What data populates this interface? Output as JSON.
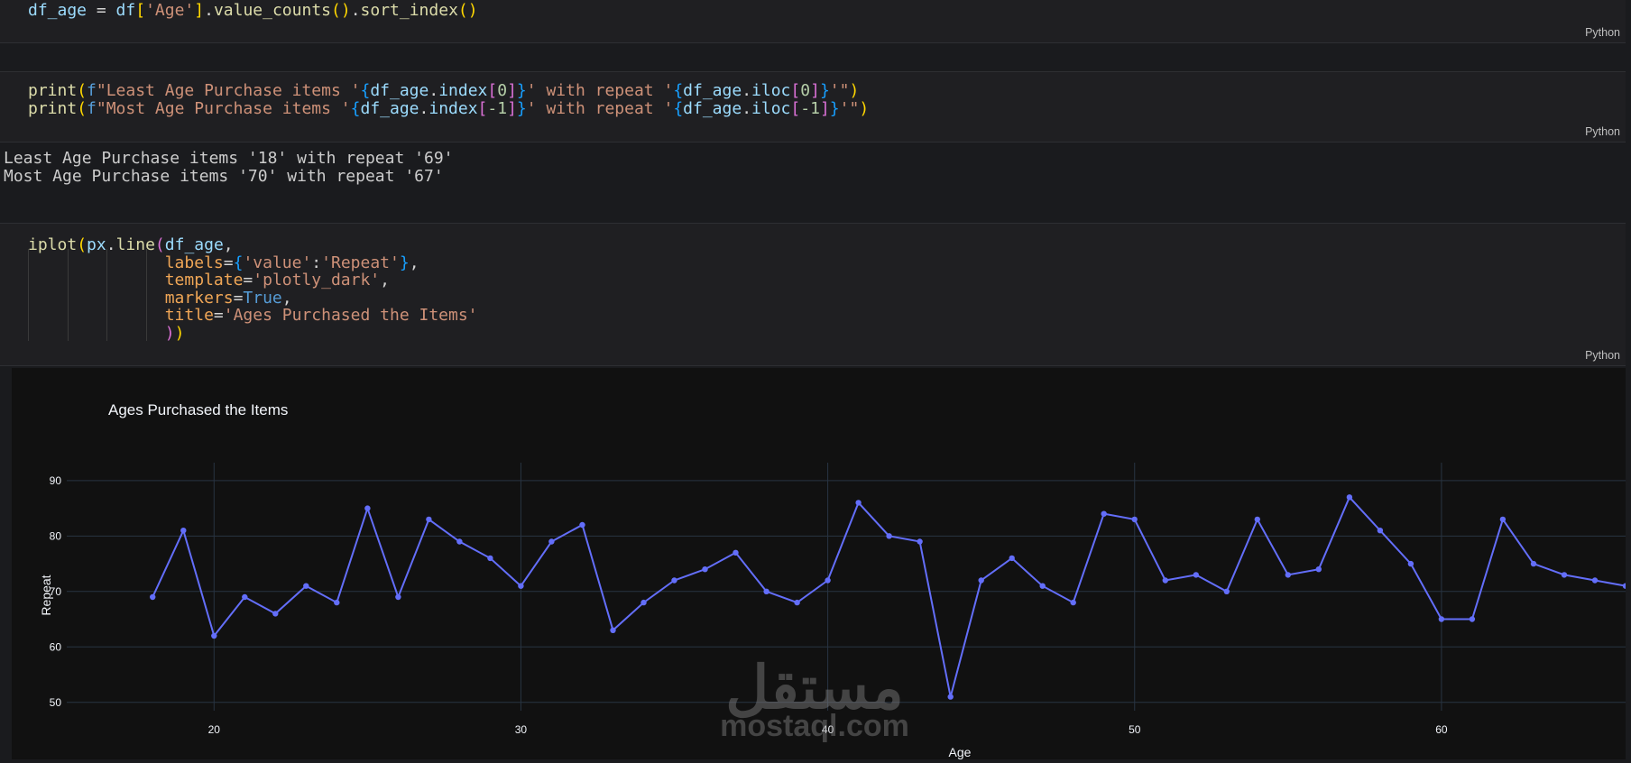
{
  "cells": {
    "cell1": {
      "language": "Python"
    },
    "cell2": {
      "language": "Python"
    },
    "cell3": {
      "language": "Python"
    }
  },
  "output": {
    "line1": "Least Age Purchase items '18' with repeat '69'",
    "line2": "Most Age Purchase items '70' with repeat '67'"
  },
  "watermark": {
    "arabic": "مستقل",
    "latin": "mostaql.com"
  },
  "colors": {
    "line": "#636efa",
    "background": "#111111",
    "grid": "#283442"
  },
  "chart_data": {
    "type": "line",
    "title": "Ages Purchased the Items",
    "xlabel": "Age",
    "ylabel": "Repeat",
    "x": [
      18,
      19,
      20,
      21,
      22,
      23,
      24,
      25,
      26,
      27,
      28,
      29,
      30,
      31,
      32,
      33,
      34,
      35,
      36,
      37,
      38,
      39,
      40,
      41,
      42,
      43,
      44,
      45,
      46,
      47,
      48,
      49,
      50,
      51,
      52,
      53,
      54,
      55,
      56,
      57,
      58,
      59,
      60,
      61,
      62,
      63,
      64,
      65,
      66
    ],
    "series": [
      {
        "values": [
          69,
          81,
          62,
          69,
          66,
          71,
          68,
          85,
          69,
          83,
          79,
          76,
          71,
          79,
          82,
          63,
          68,
          72,
          74,
          77,
          70,
          68,
          72,
          86,
          80,
          79,
          51,
          72,
          76,
          71,
          68,
          84,
          83,
          72,
          73,
          70,
          83,
          73,
          74,
          87,
          81,
          75,
          65,
          65,
          83,
          75,
          73,
          72,
          71
        ]
      }
    ],
    "xticks": [
      20,
      30,
      40,
      50,
      60
    ],
    "yticks": [
      50,
      60,
      70,
      80,
      90
    ],
    "markers": true,
    "grid": true
  }
}
